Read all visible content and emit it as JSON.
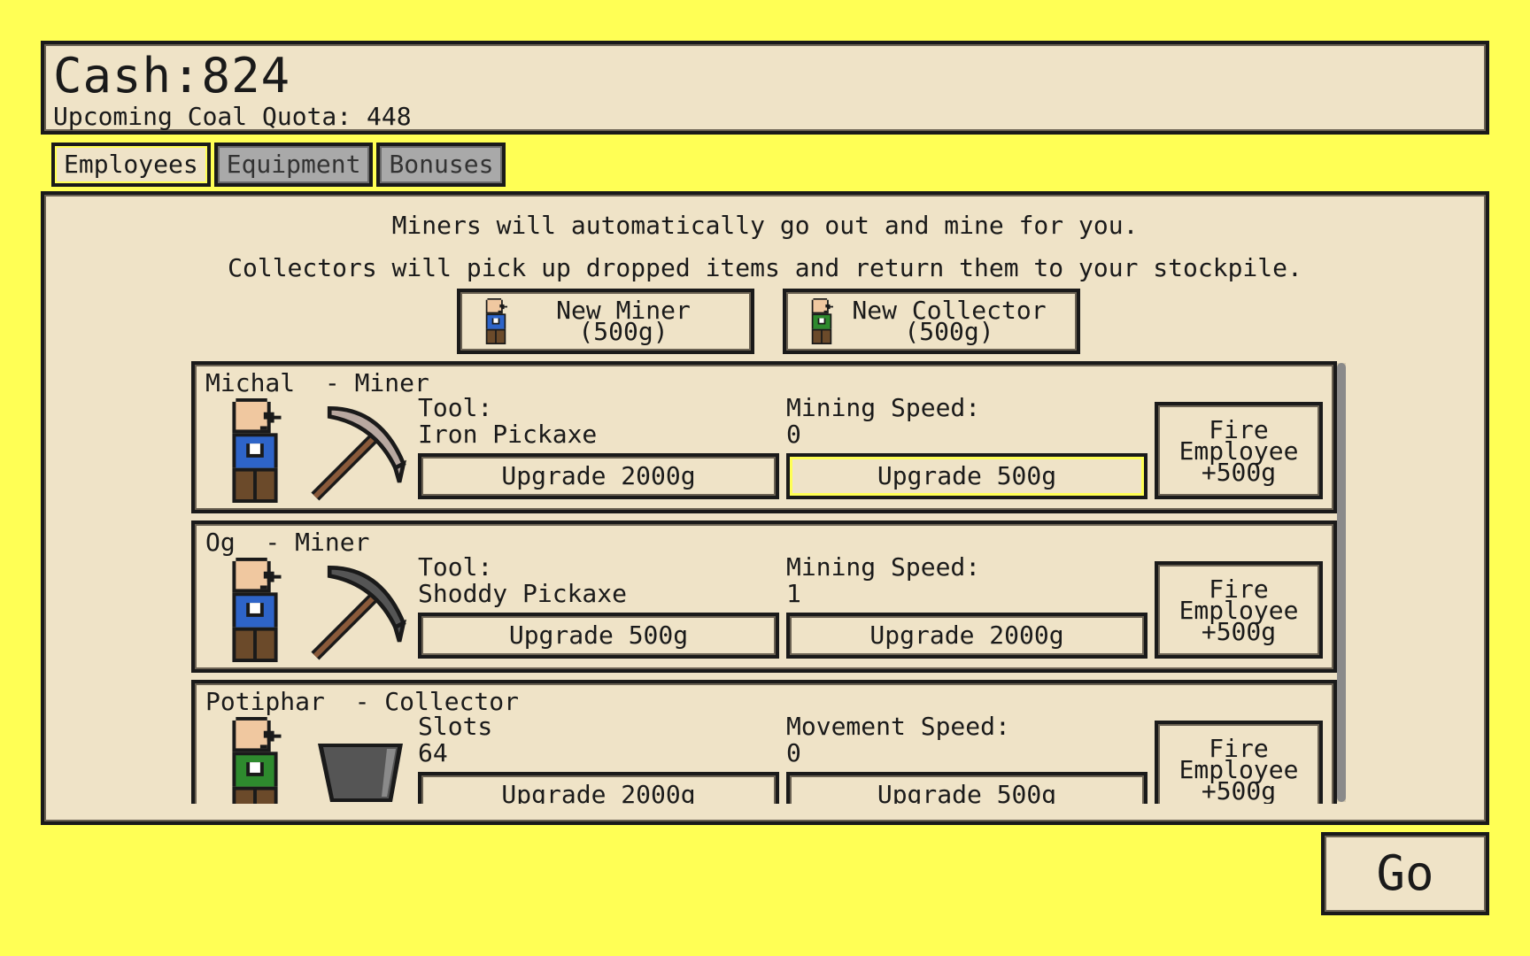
{
  "header": {
    "cash_text": "Cash:824",
    "quota_text": "Upcoming Coal Quota: 448"
  },
  "tabs": [
    {
      "label": "Employees",
      "active": true
    },
    {
      "label": "Equipment",
      "active": false
    },
    {
      "label": "Bonuses",
      "active": false
    }
  ],
  "panel": {
    "info_line1": "Miners will automatically go out and mine for you.",
    "info_line2": "Collectors will pick up dropped items and return them to your stockpile.",
    "hire_miner_line1": "New Miner",
    "hire_miner_line2": "(500g)",
    "hire_collector_line1": "New Collector",
    "hire_collector_line2": "(500g)"
  },
  "employees": [
    {
      "name_role": "Michal  - Miner",
      "tool_label": "Tool:",
      "tool_value": "Iron Pickaxe",
      "tool_upgrade": "Upgrade 2000g",
      "speed_label": "Mining Speed:",
      "speed_value": "0",
      "speed_upgrade": "Upgrade 500g",
      "fire_line1": "Fire",
      "fire_line2": "Employee",
      "fire_line3": "+500g"
    },
    {
      "name_role": "Og  - Miner",
      "tool_label": "Tool:",
      "tool_value": "Shoddy Pickaxe",
      "tool_upgrade": "Upgrade 500g",
      "speed_label": "Mining Speed:",
      "speed_value": "1",
      "speed_upgrade": "Upgrade 2000g",
      "fire_line1": "Fire",
      "fire_line2": "Employee",
      "fire_line3": "+500g"
    },
    {
      "name_role": "Potiphar  - Collector",
      "tool_label": "Slots",
      "tool_value": "64",
      "tool_upgrade": "Upgrade 2000g",
      "speed_label": "Movement Speed:",
      "speed_value": "0",
      "speed_upgrade": "Upgrade 500g",
      "fire_line1": "Fire",
      "fire_line2": "Employee",
      "fire_line3": "+500g"
    }
  ],
  "go_label": "Go",
  "colors": {
    "background": "#ffff55",
    "panel": "#efe3c7",
    "miner_shirt": "#2e64c8",
    "collector_shirt": "#2e8a2e",
    "iron_pickaxe_head": "#b8a8a0",
    "shoddy_pickaxe_head": "#555555"
  },
  "icons": {
    "miner": "miner-avatar-icon",
    "collector": "collector-avatar-icon",
    "iron_pickaxe": "iron-pickaxe-icon",
    "shoddy_pickaxe": "shoddy-pickaxe-icon",
    "bucket": "bucket-icon"
  }
}
